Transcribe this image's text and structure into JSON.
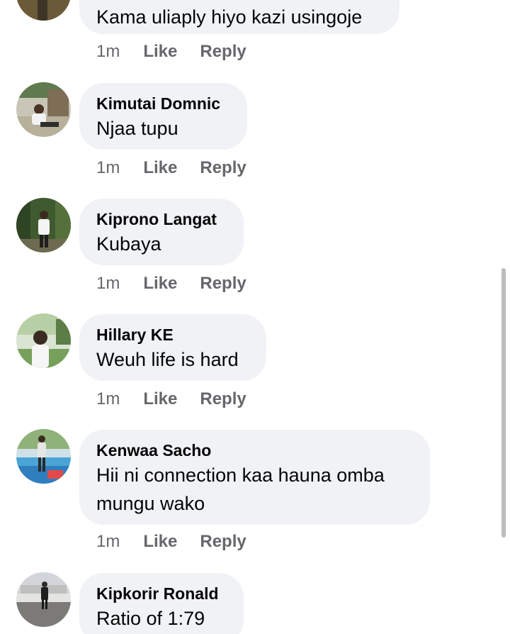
{
  "comments": [
    {
      "author": "",
      "text": "Kama uliaply hiyo kazi usingoje",
      "time": "1m",
      "like_label": "Like",
      "reply_label": "Reply"
    },
    {
      "author": "Kimutai Domnic",
      "text": "Njaa tupu",
      "time": "1m",
      "like_label": "Like",
      "reply_label": "Reply"
    },
    {
      "author": "Kiprono Langat",
      "text": "Kubaya",
      "time": "1m",
      "like_label": "Like",
      "reply_label": "Reply"
    },
    {
      "author": "Hillary KE",
      "text": "Weuh life is hard",
      "time": "1m",
      "like_label": "Like",
      "reply_label": "Reply"
    },
    {
      "author": "Kenwaa Sacho",
      "text_line1": "Hii ni connection  kaa hauna omba",
      "text_line2": "mungu wako",
      "time": "1m",
      "like_label": "Like",
      "reply_label": "Reply"
    },
    {
      "author": "Kipkorir Ronald",
      "text": "Ratio of 1:79"
    }
  ],
  "colors": {
    "bubble": "#f0f2f5",
    "text": "#050505",
    "meta": "#65676b"
  }
}
